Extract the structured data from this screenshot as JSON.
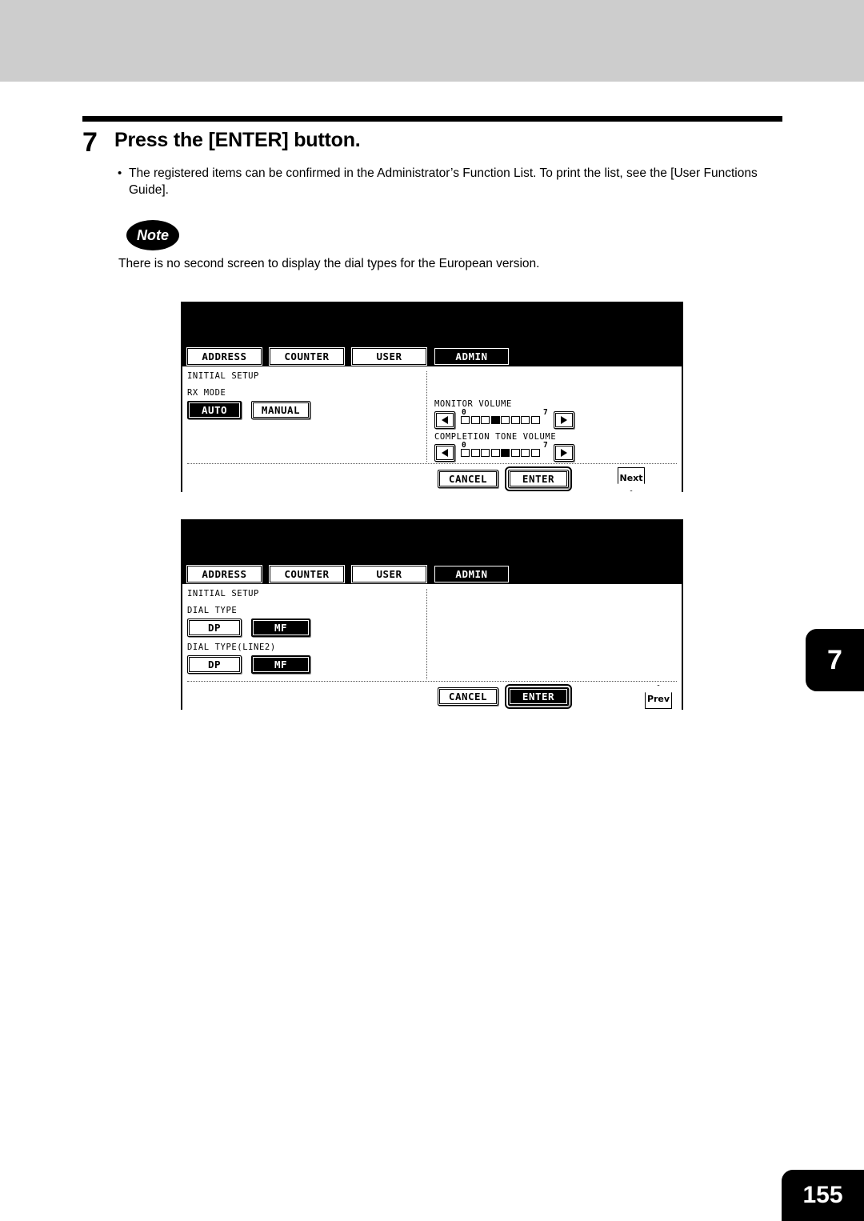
{
  "page": {
    "number": "155",
    "chapter_tab": "7"
  },
  "step": {
    "number": "7",
    "title": "Press the [ENTER] button.",
    "bullet_marker": "•",
    "bullet_text": "The registered items can be confirmed in the Administrator’s Function List. To print the list, see the [User Functions Guide]."
  },
  "note": {
    "badge": "Note",
    "text": "There is no second screen to display the dial types for the European version."
  },
  "screens": [
    {
      "id": "initial-setup-rx-mode",
      "tabs": [
        {
          "label": "ADDRESS",
          "active": false
        },
        {
          "label": "COUNTER",
          "active": false
        },
        {
          "label": "USER",
          "active": false
        },
        {
          "label": "ADMIN",
          "active": true
        }
      ],
      "screen_title": "INITIAL SETUP",
      "left_group": {
        "label": "RX MODE",
        "options": [
          {
            "label": "AUTO",
            "selected": true
          },
          {
            "label": "MANUAL",
            "selected": false
          }
        ]
      },
      "volumes": [
        {
          "label": "MONITOR VOLUME",
          "min": "0",
          "max": "7",
          "segments": 8,
          "value": 3,
          "decrease_icon": "left-triangle-icon",
          "increase_icon": "right-triangle-icon"
        },
        {
          "label": "COMPLETION TONE VOLUME",
          "min": "0",
          "max": "7",
          "segments": 8,
          "value": 4,
          "decrease_icon": "left-triangle-icon",
          "increase_icon": "right-triangle-icon"
        }
      ],
      "actions": {
        "cancel": "CANCEL",
        "enter": "ENTER",
        "enter_selected": false,
        "nav": {
          "label": "Next",
          "icon": "next-down-tab-icon"
        }
      }
    },
    {
      "id": "initial-setup-dial-type",
      "tabs": [
        {
          "label": "ADDRESS",
          "active": false
        },
        {
          "label": "COUNTER",
          "active": false
        },
        {
          "label": "USER",
          "active": false
        },
        {
          "label": "ADMIN",
          "active": true
        }
      ],
      "screen_title": "INITIAL SETUP",
      "groups": [
        {
          "label": "DIAL TYPE",
          "options": [
            {
              "label": "DP",
              "selected": false
            },
            {
              "label": "MF",
              "selected": true
            }
          ]
        },
        {
          "label": "DIAL TYPE(LINE2)",
          "options": [
            {
              "label": "DP",
              "selected": false
            },
            {
              "label": "MF",
              "selected": true
            }
          ]
        }
      ],
      "actions": {
        "cancel": "CANCEL",
        "enter": "ENTER",
        "enter_selected": true,
        "nav": {
          "label": "Prev",
          "icon": "prev-up-tab-icon"
        }
      }
    }
  ],
  "colors": {
    "top_band": "#cdcdcd",
    "ink": "#000000",
    "paper": "#ffffff"
  }
}
